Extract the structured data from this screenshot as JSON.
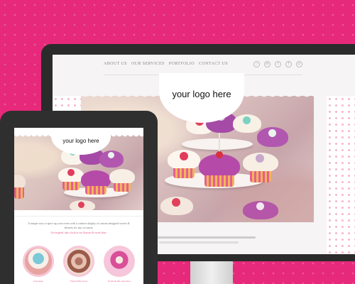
{
  "background": {
    "color": "#e6297a",
    "dot_color": "#ff5a9c"
  },
  "desktop": {
    "nav_items": [
      "ABOUT US",
      "OUR SERVICES",
      "PORTFOLIO",
      "CONTACT US"
    ],
    "social_icons": [
      "share-icon",
      "linkedin-icon",
      "twitter-icon",
      "facebook-icon",
      "pinterest-icon"
    ],
    "logo_text": "your logo here"
  },
  "tablet": {
    "logo_text": "your logo here",
    "intro_line": "A unique way to spice up your event with a creative display of custom designed sweets & desserts for any occasion.",
    "sub_line": "Get inspired, take a look at our flavours & sweet ideas.",
    "features": [
      {
        "caption": "Cupcakes"
      },
      {
        "caption": "French Macarons"
      },
      {
        "caption": "Petite & bite cupcakes"
      }
    ]
  },
  "colors": {
    "accent": "#e55a8a",
    "frame": "#2b2b2b"
  }
}
